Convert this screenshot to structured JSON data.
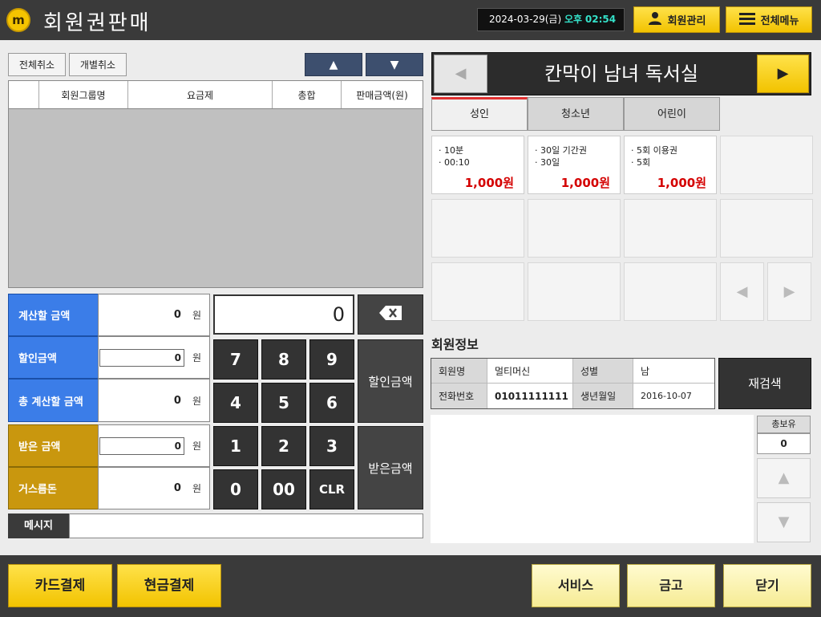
{
  "header": {
    "logo_text": "m",
    "title": "회원권판매",
    "date": "2024-03-29(금)",
    "ampm": "오후",
    "time": "02:54",
    "member_mgmt_label": "회원관리",
    "all_menu_label": "전체메뉴"
  },
  "toolbar": {
    "cancel_all_label": "전체취소",
    "cancel_each_label": "개별취소",
    "up_icon": "▲",
    "down_icon": "▼"
  },
  "sales_table": {
    "columns": [
      "",
      "회원그룹명",
      "요금제",
      "총합",
      "판매금액(원)"
    ],
    "rows": []
  },
  "calc": {
    "due_label": "계산할 금액",
    "due_value": "0",
    "discount_label": "할인금액",
    "discount_value": "0",
    "total_due_label": "총 계산할 금액",
    "total_due_value": "0",
    "received_label": "받은 금액",
    "received_value": "0",
    "change_label": "거스름돈",
    "change_value": "0",
    "unit": "원"
  },
  "keypad": {
    "display": "0",
    "keys": [
      "7",
      "8",
      "9",
      "4",
      "5",
      "6",
      "1",
      "2",
      "3",
      "0",
      "00",
      "CLR"
    ],
    "discount_btn": "할인금액",
    "received_btn": "받은금액"
  },
  "message": {
    "label": "메시지",
    "value": ""
  },
  "store": {
    "name": "칸막이 남녀 독서실",
    "prev_icon": "◀",
    "next_icon": "▶"
  },
  "tabs": [
    {
      "label": "성인",
      "active": true
    },
    {
      "label": "청소년",
      "active": false
    },
    {
      "label": "어린이",
      "active": false
    }
  ],
  "products": [
    {
      "line1": "· 10분",
      "line2": "· 00:10",
      "price": "1,000원"
    },
    {
      "line1": "· 30일 기간권",
      "line2": "· 30일",
      "price": "1,000원"
    },
    {
      "line1": "· 5회 이용권",
      "line2": "· 5회",
      "price": "1,000원"
    }
  ],
  "member_info": {
    "section_title": "회원정보",
    "name_label": "회원명",
    "name_value": "멀티머신",
    "gender_label": "성별",
    "gender_value": "남",
    "phone_label": "전화번호",
    "phone_value": "01011111111",
    "birth_label": "생년월일",
    "birth_value": "2016-10-07",
    "research_label": "재검색",
    "hold_label": "총보유",
    "hold_value": "0"
  },
  "footer": {
    "card_pay": "카드결제",
    "cash_pay": "현금결제",
    "service": "서비스",
    "cashbox": "금고",
    "close": "닫기"
  },
  "colors": {
    "header_bg": "#3a3a3a",
    "accent_yellow": "#f2c300",
    "blue_label": "#3b7de8",
    "gold_label": "#c9970e",
    "price_red": "#d40000"
  }
}
